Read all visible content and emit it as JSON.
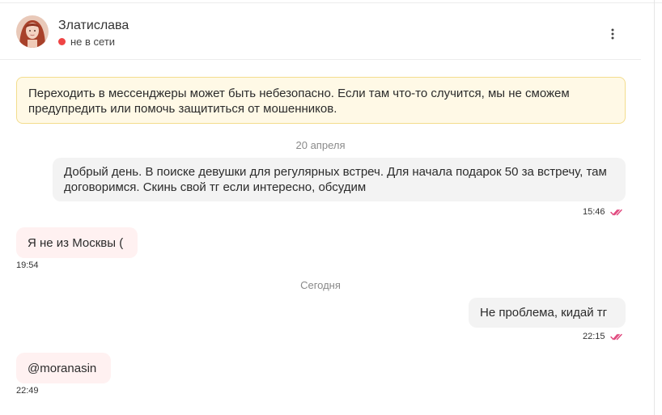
{
  "header": {
    "contact_name": "Златислава",
    "status_text": "не в сети"
  },
  "warning": {
    "text": "Переходить в мессенджеры может быть небезопасно. Если там что-то случится, мы не сможем предупредить или помочь защититься от мошенников."
  },
  "dates": [
    "20 апреля",
    "Сегодня"
  ],
  "messages": [
    {
      "direction": "out",
      "text": "Добрый день. В поиске девушки для регулярных встреч. Для начала подарок 50 за встречу, там договоримся. Скинь свой тг если интересно, обсудим",
      "time": "15:46",
      "read": true
    },
    {
      "direction": "in",
      "text": "Я не из Москвы (",
      "time": "19:54"
    },
    {
      "direction": "out",
      "text": "Не проблема, кидай тг",
      "time": "22:15",
      "read": true
    },
    {
      "direction": "in",
      "text": "@moranasin",
      "time": "22:49"
    }
  ],
  "colors": {
    "offline_dot": "#ef4444",
    "warning_bg": "#fff9e6",
    "warning_border": "#f3dd8e",
    "incoming_bubble": "#fff1f1",
    "outgoing_bubble": "#f3f3f3",
    "read_ticks": "#e0457b"
  },
  "icons": {
    "more": "vertical-dots",
    "read_receipt": "double-check"
  }
}
